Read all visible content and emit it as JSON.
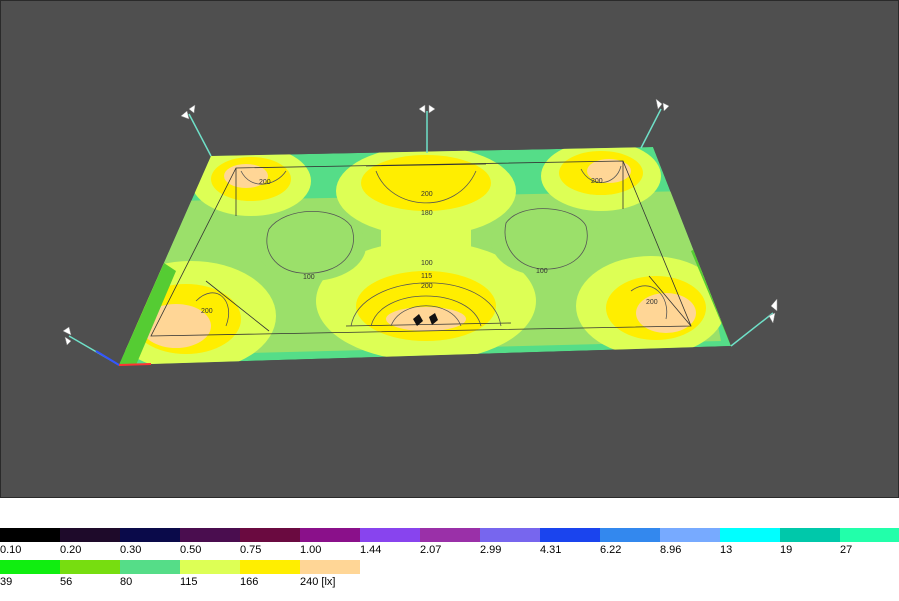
{
  "legend": {
    "unit_suffix": "[lx]",
    "row1": [
      {
        "value": "0.10",
        "color": "#000000"
      },
      {
        "value": "0.20",
        "color": "#1e0a2a"
      },
      {
        "value": "0.30",
        "color": "#0a0a4a"
      },
      {
        "value": "0.50",
        "color": "#4a0d4f"
      },
      {
        "value": "0.75",
        "color": "#6a0a40"
      },
      {
        "value": "1.00",
        "color": "#8a108a"
      },
      {
        "value": "1.44",
        "color": "#8844ee"
      },
      {
        "value": "2.07",
        "color": "#9a30a8"
      },
      {
        "value": "2.99",
        "color": "#7766ee"
      },
      {
        "value": "4.31",
        "color": "#1a44ee"
      },
      {
        "value": "6.22",
        "color": "#3388ee"
      },
      {
        "value": "8.96",
        "color": "#77aaff"
      },
      {
        "value": "13",
        "color": "#00ffff"
      },
      {
        "value": "19",
        "color": "#00c8aa"
      },
      {
        "value": "27",
        "color": "#22ffaa"
      }
    ],
    "row2": [
      {
        "value": "39",
        "color": "#10ee10"
      },
      {
        "value": "56",
        "color": "#77dd10"
      },
      {
        "value": "80",
        "color": "#55dd88"
      },
      {
        "value": "115",
        "color": "#ddff55"
      },
      {
        "value": "166",
        "color": "#ffee00"
      },
      {
        "value": "240 [lx]",
        "color": "#ffd696"
      }
    ]
  },
  "scene": {
    "background": "#4f4f4f",
    "contour_labels": {
      "top_center_outer": "200",
      "top_center_inner": "180",
      "mid_left": "100",
      "mid_right": "100",
      "bottom_center_a": "100",
      "bottom_center_b": "115",
      "bottom_center_c": "200",
      "corner_tl": "200",
      "corner_tr": "200",
      "corner_bl": "200",
      "corner_br": "200"
    }
  }
}
